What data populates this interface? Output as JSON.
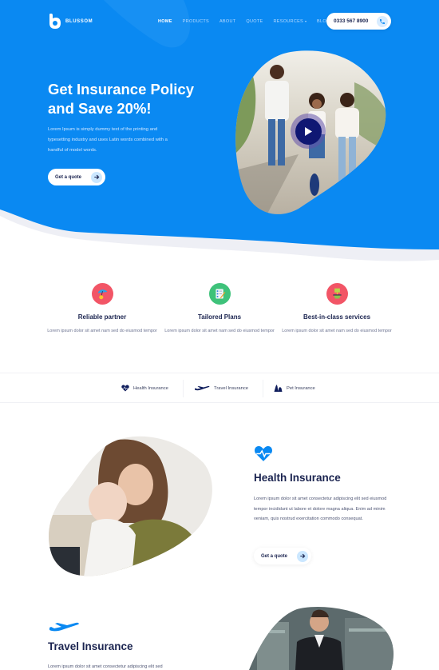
{
  "brand": {
    "name": "BLUSSOM",
    "primary": "#0a89f2",
    "dark": "#1b2450",
    "accent_light": "#cbe7ff"
  },
  "nav": {
    "items": [
      {
        "label": "HOME",
        "active": true
      },
      {
        "label": "PRODUCTS",
        "active": false
      },
      {
        "label": "ABOUT",
        "active": false
      },
      {
        "label": "QUOTE",
        "active": false
      },
      {
        "label": "RESOURCES",
        "active": false,
        "has_dropdown": true
      },
      {
        "label": "BLOG",
        "active": false
      }
    ],
    "phone": "0333 567 8900",
    "phone_icon": "phone-icon"
  },
  "hero": {
    "title_line1": "Get Insurance Policy",
    "title_line2": "and Save 20%!",
    "description": "Lorem Ipsum is simply dummy text of the printing and typesetting industry and uses Latin words combined with a handful of model words.",
    "cta_label": "Get a quote",
    "cta_icon": "arrow-right-icon",
    "media_icon": "play-icon"
  },
  "features": [
    {
      "title": "Reliable partner",
      "description": "Lorem ipsum dolor sit amet nam sed do eiusmod tempor",
      "icon": "umbrella-icon",
      "icon_bg": "#f25566"
    },
    {
      "title": "Tailored Plans",
      "description": "Lorem ipsum dolor sit amet nam sed do eiusmod tempor",
      "icon": "checklist-icon",
      "icon_bg": "#3ec27a"
    },
    {
      "title": "Best-in-class services",
      "description": "Lorem ipsum dolor sit amet nam sed do eiusmod tempor",
      "icon": "award-icon",
      "icon_bg": "#f25566"
    }
  ],
  "tabs": [
    {
      "label": "Health Insurance",
      "icon": "heart-pulse-icon"
    },
    {
      "label": "Travel Insurance",
      "icon": "airplane-icon"
    },
    {
      "label": "Pet Insurance",
      "icon": "pet-icon"
    }
  ],
  "health": {
    "title": "Health Insurance",
    "description": "Lorem ipsum dolor sit amet consectetur adipiscing elit sed eiusmod tempor incididunt ut labore et dolore magna aliqua. Enim ad minim veniam, quis nostrud exercitation commodo consequat.",
    "cta_label": "Get a quote"
  },
  "travel": {
    "title": "Travel Insurance",
    "description": "Lorem ipsum dolor sit amet consectetur adipiscing elit sed"
  }
}
